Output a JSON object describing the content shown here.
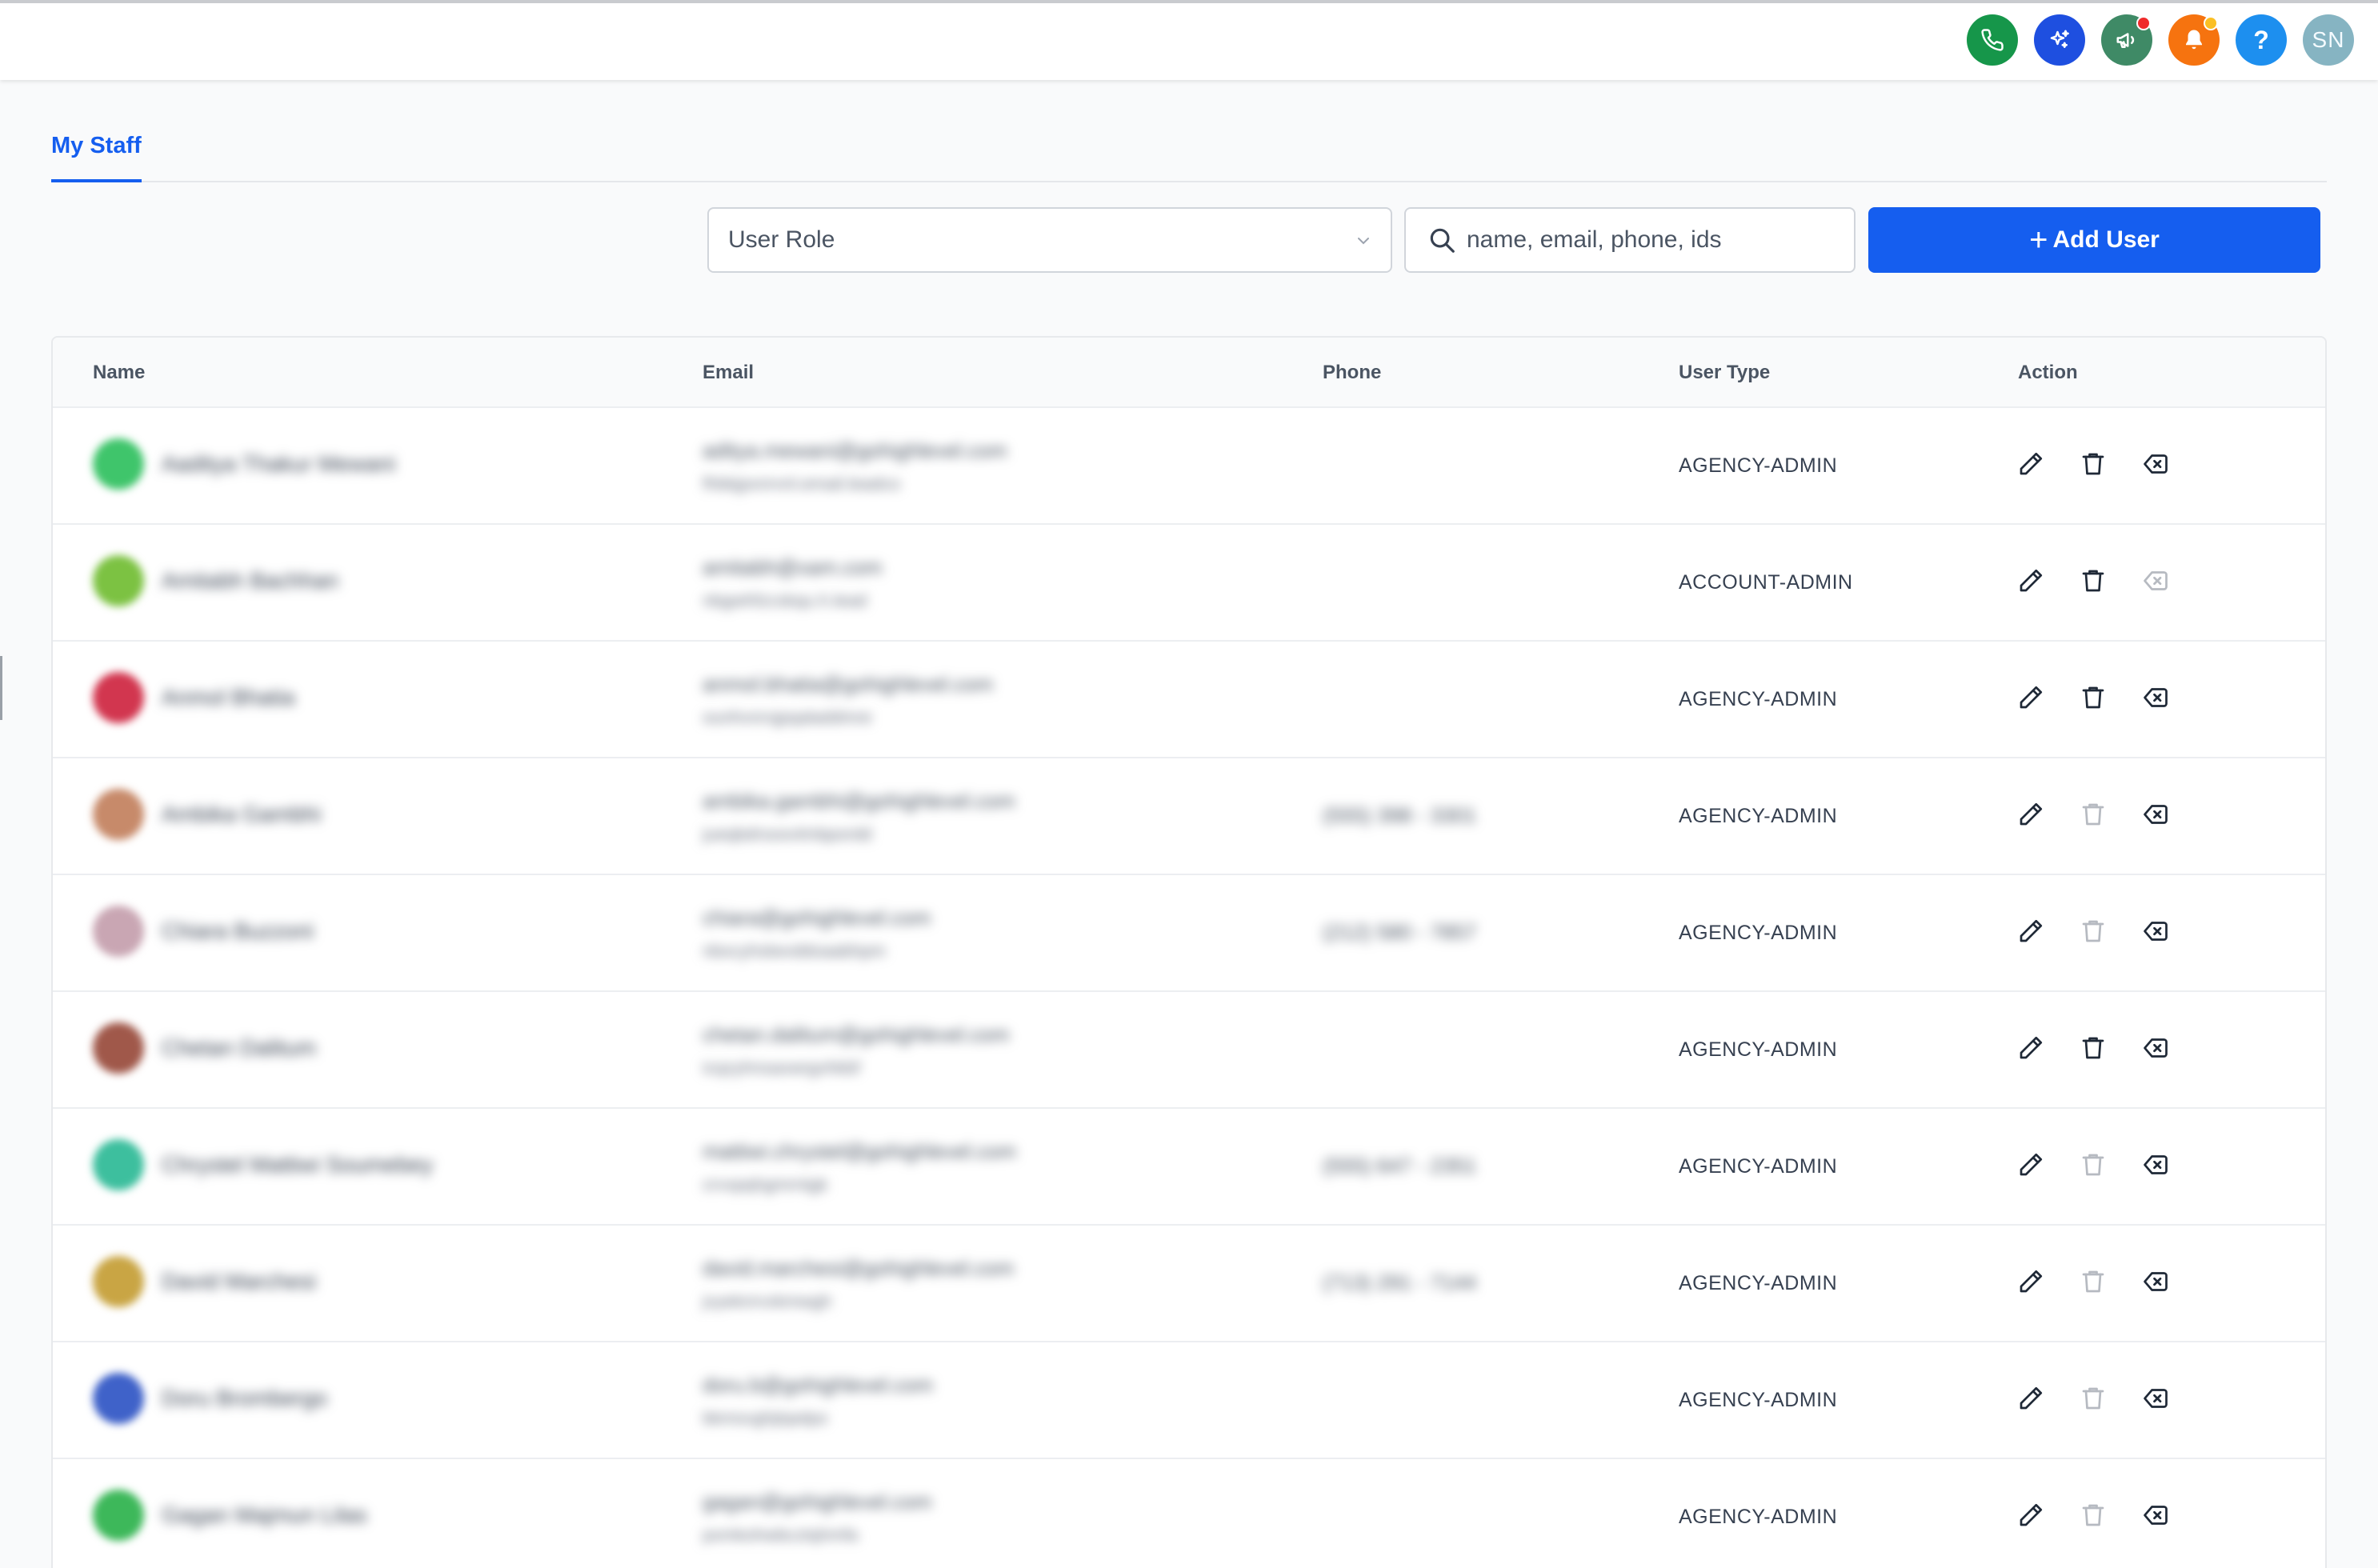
{
  "header": {
    "icons": [
      "phone-icon",
      "ai-sparkle-icon",
      "megaphone-icon",
      "bell-icon",
      "help-icon"
    ],
    "help_label": "?",
    "user_initials": "SN"
  },
  "tabs": [
    {
      "label": "My Staff",
      "active": true
    }
  ],
  "filters": {
    "role_select": "User Role",
    "search_placeholder": "name, email, phone, ids",
    "add_user_label": "Add User"
  },
  "table": {
    "columns": [
      "Name",
      "Email",
      "Phone",
      "User Type",
      "Action"
    ],
    "rows": [
      {
        "name": "Aaditya Thakur Mewani",
        "email": "aditya.mewani@gohighlevel.com",
        "email_sub": "fhbkjpxnrvnl.email.leadco",
        "phone": "",
        "user_type": "AGENCY-ADMIN",
        "avatar_color": "#3fc56b",
        "delete_enabled": true,
        "remove_enabled": true
      },
      {
        "name": "Amitabh Bachhan",
        "email": "amitabh@xam.com",
        "email_sub": "nbgwhfzcskqu.h.lead",
        "phone": "",
        "user_type": "ACCOUNT-ADMIN",
        "avatar_color": "#7cc242",
        "delete_enabled": true,
        "remove_enabled": false
      },
      {
        "name": "Anmol Bhatia",
        "email": "anmol.bhatia@gohighlevel.com",
        "email_sub": "ounhvnrxjpqaladdmre",
        "phone": "",
        "user_type": "AGENCY-ADMIN",
        "avatar_color": "#d2364f",
        "delete_enabled": true,
        "remove_enabled": true
      },
      {
        "name": "Ambika Gambhi",
        "email": "ambika.gambhi@gohighlevel.com",
        "email_sub": "jueqbdrsoovlmbpordd",
        "phone": "(555) 398 - 3301",
        "user_type": "AGENCY-ADMIN",
        "avatar_color": "#c78a6a",
        "delete_enabled": false,
        "remove_enabled": true
      },
      {
        "name": "Chiara Buzzoni",
        "email": "chiara@gohighlevel.com",
        "email_sub": "nbxcyhslwvddoaabhpm",
        "phone": "(212) 580 - 7857",
        "user_type": "AGENCY-ADMIN",
        "avatar_color": "#c9a6b3",
        "delete_enabled": false,
        "remove_enabled": true
      },
      {
        "name": "Chetan Dalitum",
        "email": "chetan.dalitum@gohighlevel.com",
        "email_sub": "icqzyhnsaxwrgvhkbf",
        "phone": "",
        "user_type": "AGENCY-ADMIN",
        "avatar_color": "#a0584a",
        "delete_enabled": true,
        "remove_enabled": true
      },
      {
        "name": "Chrystel Mattiwi Soumebey",
        "email": "mattiwi.chrystel@gohighlevel.com",
        "email_sub": "crvxpqhgmrntgk",
        "phone": "(555) 647 - 2351",
        "user_type": "AGENCY-ADMIN",
        "avatar_color": "#3dbf9e",
        "delete_enabled": false,
        "remove_enabled": true
      },
      {
        "name": "David Marchesi",
        "email": "david.marchesi@gohighlevel.com",
        "email_sub": "jvyeknrvxkmwgh",
        "phone": "(713) 291 - 7144",
        "user_type": "AGENCY-ADMIN",
        "avatar_color": "#c9a544",
        "delete_enabled": false,
        "remove_enabled": true
      },
      {
        "name": "Doru Brombergo",
        "email": "doru.b@gohighlevel.com",
        "email_sub": "bkmsvghjtqwlpo",
        "phone": "",
        "user_type": "AGENCY-ADMIN",
        "avatar_color": "#3f62c9",
        "delete_enabled": false,
        "remove_enabled": true
      },
      {
        "name": "Gagan Majmun Lilas",
        "email": "gagan@gohighlevel.com",
        "email_sub": "pxmkohwbcztqhmfa",
        "phone": "",
        "user_type": "AGENCY-ADMIN",
        "avatar_color": "#3db85a",
        "delete_enabled": false,
        "remove_enabled": true
      }
    ]
  },
  "colors": {
    "primary": "#155eef",
    "border": "#e5e7eb"
  }
}
